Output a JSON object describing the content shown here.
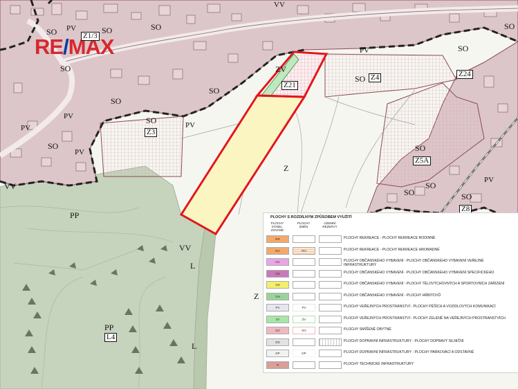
{
  "brand": {
    "logo_left": "RE",
    "logo_slash": "/",
    "logo_right": "MAX"
  },
  "map_labels": {
    "vv_top": "VV",
    "so_1": "SO",
    "pv_1": "PV",
    "z1_3": "Z1/3",
    "so_2": "SO",
    "so_3": "SO",
    "so_4": "SO",
    "pv_2": "PV",
    "so_5": "SO",
    "so_6": "SO",
    "so_7": "SO",
    "zv": "ZV",
    "z21": "Z21",
    "so_z4": "SO",
    "z4": "Z4",
    "pv_3": "PV",
    "z24": "Z24",
    "so_8": "SO",
    "so_9": "SO",
    "pv_4": "PV",
    "so_10": "SO",
    "z3": "Z3",
    "pv_5": "PV",
    "pv_6": "PV",
    "so_11": "SO",
    "pv_7": "PV",
    "vv_left": "VV",
    "so_12": "SO",
    "z5a": "Z5A",
    "so_13": "SO",
    "so_14": "SO",
    "z8": "Z8",
    "z_1": "Z",
    "z_2": "Z",
    "pp_1": "PP",
    "vv_mid": "VV",
    "l_1": "L",
    "pp_2": "PP",
    "l4": "L4",
    "l_2": "L"
  },
  "legend": {
    "title": "PLOCHY S ROZDÍLNÝM ZPŮSOBEM VYUŽITÍ",
    "headers": [
      "PLOCHY STABIL. ZOVANÉ",
      "PLOCHY ZMĚN",
      "ÚZEMNÍ REZERVY"
    ],
    "rows": [
      {
        "code_a": "RR",
        "code_b": "",
        "color": "#f4a96a",
        "hatch": false,
        "desc": "PLOCHY REKREACE - PLOCHY REKREACE RODINNÉ"
      },
      {
        "code_a": "RH",
        "code_b": "RH",
        "color": "#f4a96a",
        "hatch": true,
        "desc": "PLOCHY REKREACE - PLOCHY REKREACE HROMADNÉ"
      },
      {
        "code_a": "OV",
        "code_b": "",
        "color": "#e8a6e6",
        "hatch": false,
        "desc": "PLOCHY OBČANSKÉHO VYBAVENÍ - PLOCHY OBČANSKÉHO VYBAVENÍ VEŘEJNÉ INFRASTRUKTURY"
      },
      {
        "code_a": "OK",
        "code_b": "",
        "color": "#c87ab8",
        "hatch": false,
        "desc": "PLOCHY OBČANSKÉHO VYBAVENÍ - PLOCHY OBČANSKÉHO VYBAVENÍ SPECIFICKÉHO"
      },
      {
        "code_a": "OS",
        "code_b": "",
        "color": "#f2f06a",
        "hatch": false,
        "desc": "PLOCHY OBČANSKÉHO VYBAVENÍ - PLOCHY TĚLOVÝCHOVNÝCH A SPORTOVNÍCH ZAŘÍZENÍ"
      },
      {
        "code_a": "OH",
        "code_b": "",
        "color": "#9bd49b",
        "hatch": false,
        "desc": "PLOCHY OBČANSKÉHO VYBAVENÍ - PLOCHY HŘBITOVŮ"
      },
      {
        "code_a": "PV",
        "code_b": "PV",
        "color": "#e6e6f0",
        "hatch": false,
        "desc": "PLOCHY VEŘEJNÝCH PROSTRANSTVÍ - PLOCHY PĚŠÍCH A VOZIDLOVÝCH KOMUNIKACÍ"
      },
      {
        "code_a": "ZV",
        "code_b": "ZV",
        "color": "#a8e6a8",
        "hatch": false,
        "desc": "PLOCHY VEŘEJNÝCH PROSTRANSTVÍ - PLOCHY ZELENĚ NA VEŘEJNÝCH PROSTRANSTVÍCH"
      },
      {
        "code_a": "SO",
        "code_b": "SO",
        "color": "#f0b8c0",
        "hatch": false,
        "desc": "PLOCHY SMÍŠENÉ OBYTNÉ"
      },
      {
        "code_a": "DS",
        "code_b": "",
        "color": "#e2e2e2",
        "hatch": true,
        "desc": "PLOCHY DOPRAVNÍ INFRASTRUKTURY - PLOCHY DOPRAVY SILNIČNÍ"
      },
      {
        "code_a": "DP",
        "code_b": "DP",
        "color": "#f2f2f2",
        "hatch": false,
        "desc": "PLOCHY DOPRAVNÍ INFRASTRUKTURY - PLOCHY PARKOVACÍ A ODSTAVNÉ"
      },
      {
        "code_a": "TI",
        "code_b": "",
        "color": "#d9a09a",
        "hatch": false,
        "desc": "PLOCHY TECHNICKÉ INFRASTRUKTURY"
      }
    ]
  },
  "colors": {
    "residential": "#dcc6c9",
    "forest": "#c6d3bd",
    "highlight_border": "#e3161d",
    "highlight_fill": "#fbf5c2",
    "boundary": "#8a4a55"
  }
}
